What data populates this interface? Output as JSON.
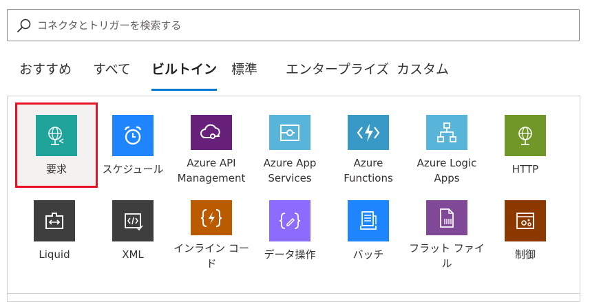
{
  "search": {
    "placeholder": "コネクタとトリガーを検索する",
    "value": ""
  },
  "tabs": [
    {
      "label": "おすすめ"
    },
    {
      "label": "すべて"
    },
    {
      "label": "ビルトイン"
    },
    {
      "label": "標準"
    },
    {
      "label": "エンタープライズ"
    },
    {
      "label": "カスタム"
    }
  ],
  "active_tab": "ビルトイン",
  "connectors": [
    {
      "label": "要求",
      "color": "#1fa39a",
      "icon": "globe-request-icon"
    },
    {
      "label": "スケジュール",
      "color": "#1f85ff",
      "icon": "alarm-clock-icon"
    },
    {
      "label": "Azure API Management",
      "color": "#68217a",
      "icon": "cloud-api-icon"
    },
    {
      "label": "Azure App Services",
      "color": "#59b4d9",
      "icon": "app-service-icon"
    },
    {
      "label": "Azure Functions",
      "color": "#3999c6",
      "icon": "functions-lightning-icon"
    },
    {
      "label": "Azure Logic Apps",
      "color": "#59b4d9",
      "icon": "logic-apps-icon"
    },
    {
      "label": "HTTP",
      "color": "#709727",
      "icon": "http-globe-icon"
    },
    {
      "label": "Liquid",
      "color": "#3e3e3e",
      "icon": "liquid-icon"
    },
    {
      "label": "XML",
      "color": "#3e3e3e",
      "icon": "xml-icon"
    },
    {
      "label": "インライン コード",
      "color": "#ba5b00",
      "icon": "inline-code-icon"
    },
    {
      "label": "データ操作",
      "color": "#8c6cff",
      "icon": "data-operations-icon"
    },
    {
      "label": "バッチ",
      "color": "#1f85ff",
      "icon": "batch-icon"
    },
    {
      "label": "フラット ファイル",
      "color": "#804998",
      "icon": "flat-file-icon"
    },
    {
      "label": "制御",
      "color": "#8c3900",
      "icon": "control-icon"
    }
  ],
  "selected_connector": "要求"
}
